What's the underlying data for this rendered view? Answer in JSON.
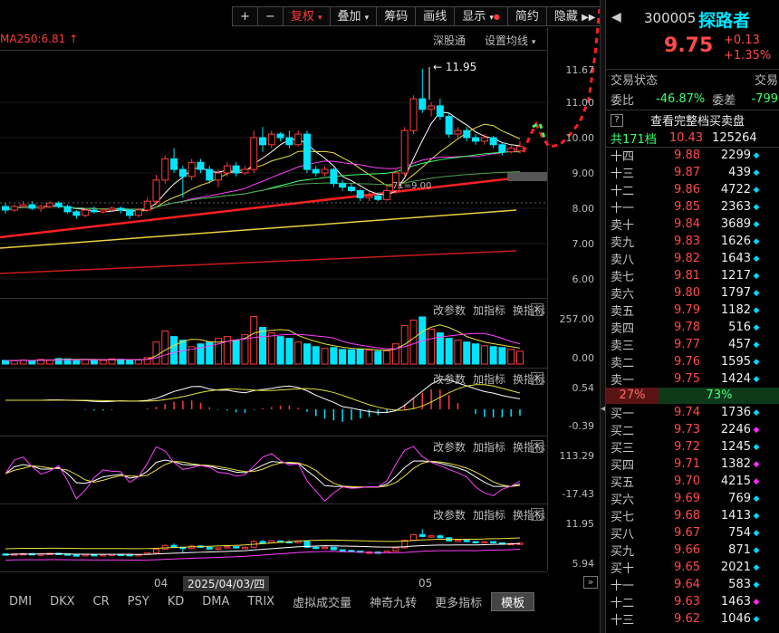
{
  "toolbar": {
    "plus": "+",
    "minus": "−",
    "fuquan": "复权",
    "diejia": "叠加",
    "chouma": "筹码",
    "huaxian": "画线",
    "xianshi": "显示",
    "jianyue": "简约",
    "yincang": "隐藏",
    "fullscreen_icon": "expand-icon"
  },
  "main_chart": {
    "ma_label": "MA250:6.81",
    "shentongtong": "深股通",
    "set_ma": "设置均线",
    "high_label": "11.95",
    "support_label": "71=9.00",
    "y_ticks": [
      "11.67",
      "11.00",
      "10.00",
      "9.00",
      "8.00",
      "7.00",
      "6.00"
    ],
    "current_price_tag": "9.00"
  },
  "panels": [
    {
      "name": "volume",
      "ticks": [
        "257.00",
        "0.00"
      ],
      "btn_a": "改参数",
      "btn_b": "加指标",
      "btn_c": "换指标"
    },
    {
      "name": "macd",
      "ticks": [
        "0.54",
        "-0.39"
      ],
      "btn_a": "改参数",
      "btn_b": "加指标",
      "btn_c": "换指标"
    },
    {
      "name": "kdj",
      "ticks": [
        "113.29",
        "-17.43"
      ],
      "btn_a": "改参数",
      "btn_b": "加指标",
      "btn_c": "换指标"
    },
    {
      "name": "boll",
      "ticks": [
        "11.95",
        "5.94"
      ],
      "btn_a": "改参数",
      "btn_b": "加指标",
      "btn_c": "换指标"
    }
  ],
  "time_axis": {
    "m1": "04",
    "date": "2025/04/03/四",
    "m2": "05"
  },
  "tabs": [
    "DMI",
    "DKX",
    "CR",
    "PSY",
    "KD",
    "DMA",
    "TRIX",
    "虚拟成交量",
    "神奇九转",
    "更多指标",
    "模板"
  ],
  "quote": {
    "code": "300005",
    "name": "探路者",
    "price": "9.75",
    "change": "+0.13",
    "change_pct": "+1.35%",
    "status_label": "交易状态",
    "status_label2": "交易",
    "weibi_label": "委比",
    "weibi": "-46.87%",
    "weicha_label": "委差",
    "weicha": "-799",
    "full_book": "查看完整档买卖盘",
    "levels_label": "共171档",
    "levels_price": "10.43",
    "levels_vol": "125264",
    "sell_pct": "27%",
    "buy_pct": "73%"
  },
  "asks": [
    {
      "label": "十四",
      "price": "9.88",
      "vol": "2299",
      "dot": "#00d8ff"
    },
    {
      "label": "十三",
      "price": "9.87",
      "vol": "439",
      "dot": "#00d8ff"
    },
    {
      "label": "十二",
      "price": "9.86",
      "vol": "4722",
      "dot": "#00d8ff"
    },
    {
      "label": "十一",
      "price": "9.85",
      "vol": "2363",
      "dot": "#00d8ff"
    },
    {
      "label": "卖十",
      "price": "9.84",
      "vol": "3689",
      "dot": "#00d8ff"
    },
    {
      "label": "卖九",
      "price": "9.83",
      "vol": "1626",
      "dot": "#00d8ff"
    },
    {
      "label": "卖八",
      "price": "9.82",
      "vol": "1643",
      "dot": "#00d8ff"
    },
    {
      "label": "卖七",
      "price": "9.81",
      "vol": "1217",
      "dot": "#00d8ff"
    },
    {
      "label": "卖六",
      "price": "9.80",
      "vol": "1797",
      "dot": "#00d8ff"
    },
    {
      "label": "卖五",
      "price": "9.79",
      "vol": "1182",
      "dot": "#00d8ff"
    },
    {
      "label": "卖四",
      "price": "9.78",
      "vol": "516",
      "dot": "#00d8ff"
    },
    {
      "label": "卖三",
      "price": "9.77",
      "vol": "457",
      "dot": "#00d8ff"
    },
    {
      "label": "卖二",
      "price": "9.76",
      "vol": "1595",
      "dot": "#00d8ff"
    },
    {
      "label": "卖一",
      "price": "9.75",
      "vol": "1424",
      "dot": "#00d8ff"
    }
  ],
  "bids": [
    {
      "label": "买一",
      "price": "9.74",
      "vol": "1736",
      "dot": "#00d8ff"
    },
    {
      "label": "买二",
      "price": "9.73",
      "vol": "2246",
      "dot": "#ff2bff"
    },
    {
      "label": "买三",
      "price": "9.72",
      "vol": "1245",
      "dot": "#00d8ff"
    },
    {
      "label": "买四",
      "price": "9.71",
      "vol": "1382",
      "dot": "#ff2bff"
    },
    {
      "label": "买五",
      "price": "9.70",
      "vol": "4215",
      "dot": "#ff2bff"
    },
    {
      "label": "买六",
      "price": "9.69",
      "vol": "769",
      "dot": "#00d8ff"
    },
    {
      "label": "买七",
      "price": "9.68",
      "vol": "1413",
      "dot": "#00d8ff"
    },
    {
      "label": "买八",
      "price": "9.67",
      "vol": "754",
      "dot": "#00d8ff"
    },
    {
      "label": "买九",
      "price": "9.66",
      "vol": "871",
      "dot": "#00d8ff"
    },
    {
      "label": "买十",
      "price": "9.65",
      "vol": "2021",
      "dot": "#00d8ff"
    },
    {
      "label": "十一",
      "price": "9.64",
      "vol": "583",
      "dot": "#00d8ff"
    },
    {
      "label": "十二",
      "price": "9.63",
      "vol": "1463",
      "dot": "#ff2bff"
    },
    {
      "label": "十三",
      "price": "9.62",
      "vol": "1046",
      "dot": "#00d8ff"
    }
  ],
  "candles": [
    {
      "o": 8.05,
      "c": 7.95,
      "h": 8.15,
      "l": 7.85
    },
    {
      "o": 7.95,
      "c": 8.05,
      "h": 8.1,
      "l": 7.9
    },
    {
      "o": 8.05,
      "c": 8.1,
      "h": 8.2,
      "l": 8.0
    },
    {
      "o": 8.1,
      "c": 8.0,
      "h": 8.2,
      "l": 7.95
    },
    {
      "o": 8.0,
      "c": 8.05,
      "h": 8.1,
      "l": 7.9
    },
    {
      "o": 8.05,
      "c": 8.15,
      "h": 8.2,
      "l": 8.0
    },
    {
      "o": 8.15,
      "c": 8.05,
      "h": 8.2,
      "l": 8.0
    },
    {
      "o": 8.05,
      "c": 7.9,
      "h": 8.1,
      "l": 7.85
    },
    {
      "o": 7.9,
      "c": 7.8,
      "h": 7.95,
      "l": 7.7
    },
    {
      "o": 7.8,
      "c": 7.95,
      "h": 8.0,
      "l": 7.75
    },
    {
      "o": 7.95,
      "c": 7.9,
      "h": 8.05,
      "l": 7.85
    },
    {
      "o": 7.9,
      "c": 7.95,
      "h": 8.0,
      "l": 7.85
    },
    {
      "o": 7.95,
      "c": 8.0,
      "h": 8.05,
      "l": 7.9
    },
    {
      "o": 8.0,
      "c": 7.95,
      "h": 8.05,
      "l": 7.85
    },
    {
      "o": 7.95,
      "c": 7.8,
      "h": 7.95,
      "l": 7.7
    },
    {
      "o": 7.8,
      "c": 7.95,
      "h": 8.0,
      "l": 7.75
    },
    {
      "o": 7.95,
      "c": 8.2,
      "h": 8.3,
      "l": 7.9
    },
    {
      "o": 8.2,
      "c": 8.8,
      "h": 8.95,
      "l": 8.1
    },
    {
      "o": 8.8,
      "c": 9.4,
      "h": 9.5,
      "l": 8.7
    },
    {
      "o": 9.4,
      "c": 9.1,
      "h": 9.7,
      "l": 9.0
    },
    {
      "o": 9.1,
      "c": 8.9,
      "h": 9.2,
      "l": 8.3
    },
    {
      "o": 8.9,
      "c": 9.3,
      "h": 9.4,
      "l": 8.8
    },
    {
      "o": 9.3,
      "c": 9.1,
      "h": 9.4,
      "l": 9.0
    },
    {
      "o": 9.1,
      "c": 8.8,
      "h": 9.2,
      "l": 8.7
    },
    {
      "o": 8.8,
      "c": 9.0,
      "h": 9.1,
      "l": 8.6
    },
    {
      "o": 9.0,
      "c": 9.2,
      "h": 9.3,
      "l": 8.9
    },
    {
      "o": 9.2,
      "c": 9.0,
      "h": 9.3,
      "l": 8.9
    },
    {
      "o": 9.0,
      "c": 9.1,
      "h": 9.2,
      "l": 8.95
    },
    {
      "o": 9.1,
      "c": 10.0,
      "h": 10.2,
      "l": 9.0
    },
    {
      "o": 10.0,
      "c": 9.8,
      "h": 10.3,
      "l": 9.6
    },
    {
      "o": 9.8,
      "c": 10.1,
      "h": 10.2,
      "l": 9.7
    },
    {
      "o": 10.1,
      "c": 10.0,
      "h": 10.15,
      "l": 9.9
    },
    {
      "o": 10.0,
      "c": 9.8,
      "h": 10.2,
      "l": 9.7
    },
    {
      "o": 9.8,
      "c": 10.1,
      "h": 10.2,
      "l": 9.75
    },
    {
      "o": 10.1,
      "c": 9.1,
      "h": 10.2,
      "l": 9.0
    },
    {
      "o": 9.1,
      "c": 9.0,
      "h": 9.2,
      "l": 8.9
    },
    {
      "o": 9.0,
      "c": 9.1,
      "h": 9.2,
      "l": 8.9
    },
    {
      "o": 9.1,
      "c": 8.7,
      "h": 9.15,
      "l": 8.6
    },
    {
      "o": 8.7,
      "c": 8.6,
      "h": 8.8,
      "l": 8.5
    },
    {
      "o": 8.6,
      "c": 8.5,
      "h": 8.7,
      "l": 8.45
    },
    {
      "o": 8.5,
      "c": 8.3,
      "h": 8.55,
      "l": 8.2
    },
    {
      "o": 8.3,
      "c": 8.35,
      "h": 8.45,
      "l": 8.2
    },
    {
      "o": 8.35,
      "c": 8.25,
      "h": 8.45,
      "l": 8.2
    },
    {
      "o": 8.25,
      "c": 8.5,
      "h": 8.6,
      "l": 8.2
    },
    {
      "o": 8.5,
      "c": 9.0,
      "h": 9.1,
      "l": 8.4
    },
    {
      "o": 9.0,
      "c": 10.2,
      "h": 10.3,
      "l": 8.9
    },
    {
      "o": 10.2,
      "c": 11.1,
      "h": 11.2,
      "l": 10.1
    },
    {
      "o": 11.1,
      "c": 10.8,
      "h": 11.95,
      "l": 10.7
    },
    {
      "o": 10.8,
      "c": 10.9,
      "h": 11.0,
      "l": 10.6
    },
    {
      "o": 10.9,
      "c": 10.6,
      "h": 11.1,
      "l": 10.5
    },
    {
      "o": 10.6,
      "c": 10.1,
      "h": 10.7,
      "l": 10.0
    },
    {
      "o": 10.1,
      "c": 10.2,
      "h": 10.3,
      "l": 10.0
    },
    {
      "o": 10.2,
      "c": 10.0,
      "h": 10.3,
      "l": 9.9
    },
    {
      "o": 10.0,
      "c": 9.9,
      "h": 10.1,
      "l": 9.8
    },
    {
      "o": 9.9,
      "c": 10.0,
      "h": 10.1,
      "l": 9.8
    },
    {
      "o": 10.0,
      "c": 9.8,
      "h": 10.05,
      "l": 9.7
    },
    {
      "o": 9.8,
      "c": 9.6,
      "h": 9.85,
      "l": 9.5
    },
    {
      "o": 9.6,
      "c": 9.7,
      "h": 9.8,
      "l": 9.55
    },
    {
      "o": 9.62,
      "c": 9.75,
      "h": 9.9,
      "l": 9.55
    }
  ],
  "volumes": [
    20,
    18,
    22,
    20,
    25,
    22,
    30,
    28,
    22,
    25,
    22,
    20,
    28,
    26,
    20,
    22,
    35,
    120,
    180,
    150,
    130,
    95,
    110,
    120,
    140,
    150,
    130,
    160,
    260,
    200,
    170,
    150,
    140,
    120,
    110,
    95,
    85,
    90,
    80,
    78,
    82,
    75,
    70,
    72,
    110,
    210,
    240,
    257,
    190,
    170,
    140,
    130,
    120,
    110,
    100,
    95,
    90,
    80,
    70
  ]
}
